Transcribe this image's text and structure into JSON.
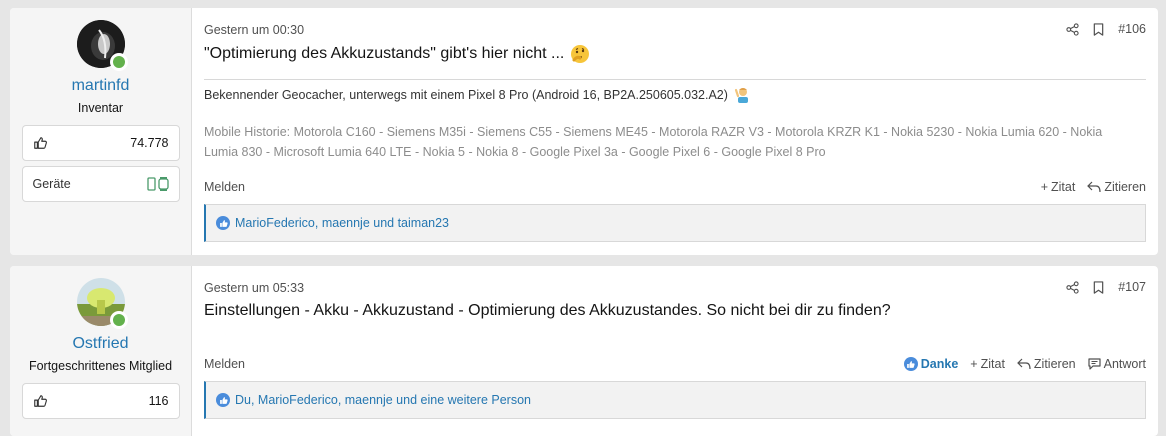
{
  "posts": [
    {
      "user": {
        "name": "martinfd",
        "title": "Inventar",
        "likes": "74.778",
        "devices_label": "Geräte"
      },
      "timestamp": "Gestern um 00:30",
      "number": "#106",
      "text": "\"Optimierung des Akkuzustands\" gibt's hier nicht ...",
      "emoji": "thinking-face-icon",
      "signature_line1": "Bekennender Geocacher, unterwegs mit einem Pixel 8 Pro (Android 16, BP2A.250605.032.A2)",
      "signature_line2": "Mobile Historie: Motorola C160 - Siemens M35i - Siemens C55 - Siemens ME45 - Motorola RAZR V3 - Motorola KRZR K1 - Nokia 5230 - Nokia Lumia 620 - Nokia",
      "signature_line3": "Lumia 830 - Microsoft Lumia 640 LTE - Nokia 5 - Nokia 8 - Google Pixel 3a - Google Pixel 6 - Google Pixel 8 Pro",
      "report": "Melden",
      "quote": "Zitat",
      "reply": "Zitieren",
      "reactions": "MarioFederico, maennje und taiman23"
    },
    {
      "user": {
        "name": "Ostfried",
        "title": "Fortgeschrittenes Mitglied",
        "likes": "116"
      },
      "timestamp": "Gestern um 05:33",
      "number": "#107",
      "text": "Einstellungen - Akku - Akkuzustand - Optimierung des Akkuzustandes. So nicht bei dir zu finden?",
      "report": "Melden",
      "thanks": "Danke",
      "quote": "Zitat",
      "reply": "Zitieren",
      "answer": "Antwort",
      "reactions": "Du, MarioFederico, maennje und eine weitere Person"
    }
  ],
  "colors": {
    "link": "#2577b1",
    "online": "#63b14c",
    "sidebar": "#f5f5f5",
    "page_bg": "#e6e6e6"
  }
}
